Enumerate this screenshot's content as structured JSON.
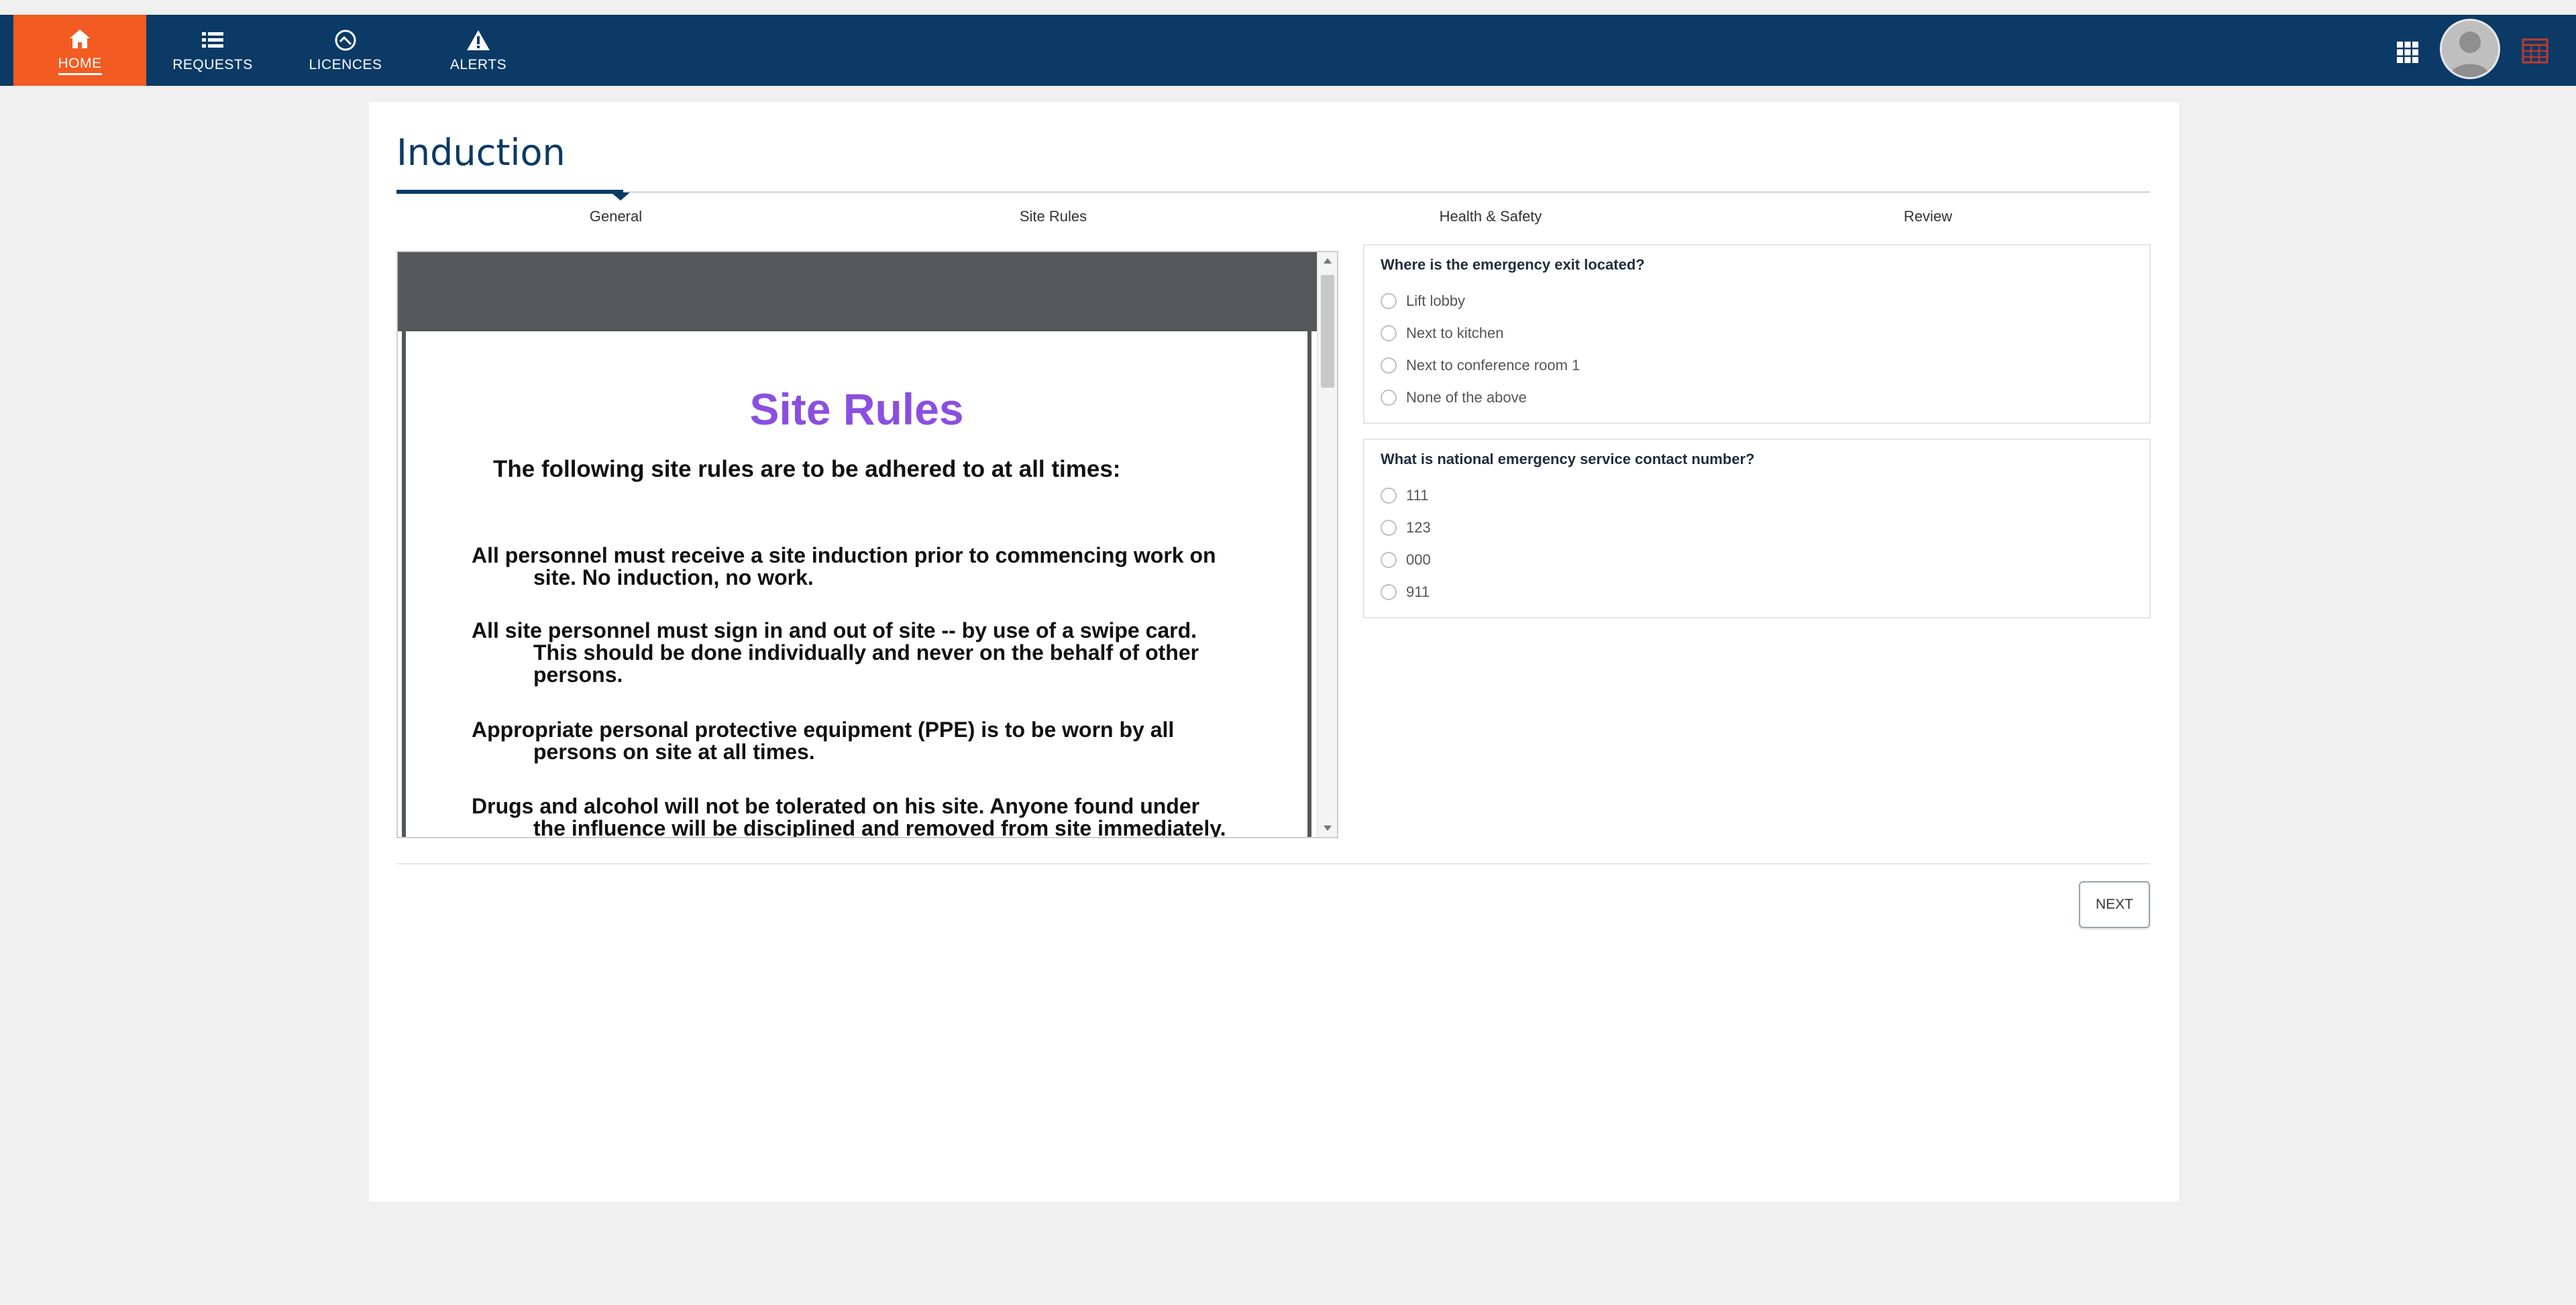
{
  "nav": {
    "items": [
      {
        "label": "HOME",
        "icon": "home-icon",
        "active": true
      },
      {
        "label": "REQUESTS",
        "icon": "list-icon",
        "active": false
      },
      {
        "label": "LICENCES",
        "icon": "licence-icon",
        "active": false
      },
      {
        "label": "ALERTS",
        "icon": "alert-icon",
        "active": false
      }
    ],
    "right_icons": [
      "apps-grid-icon",
      "user-avatar",
      "calendar-icon"
    ]
  },
  "colors": {
    "nav_bg": "#0b3a66",
    "active_tab": "#f25b22",
    "doc_heading": "#8b4fe0"
  },
  "page": {
    "title": "Induction"
  },
  "stepper": {
    "steps": [
      "General",
      "Site Rules",
      "Health & Safety",
      "Review"
    ],
    "active_index": 0
  },
  "document": {
    "heading": "Site Rules",
    "intro": "The following site rules are to be adhered to at all times:",
    "rules": [
      {
        "first": "All personnel must receive a site induction prior to commencing work on",
        "rest": "site. No induction, no work."
      },
      {
        "first": "All site personnel must sign in and out of site -- by use of a swipe card.",
        "rest": "This should be done individually and never on the behalf of other persons."
      },
      {
        "first": "Appropriate personal protective equipment (PPE) is to be worn by all",
        "rest": "persons on site at all times."
      },
      {
        "first": "Drugs and alcohol will not be tolerated on his site. Anyone found under",
        "rest": "the influence will be disciplined and removed from site immediately."
      }
    ]
  },
  "questions": [
    {
      "text": "Where is the emergency exit located?",
      "options": [
        "Lift lobby",
        "Next to kitchen",
        "Next to conference room 1",
        "None of the above"
      ]
    },
    {
      "text": "What is national emergency service contact number?",
      "options": [
        "111",
        "123",
        "000",
        "911"
      ]
    }
  ],
  "actions": {
    "next_label": "NEXT"
  }
}
